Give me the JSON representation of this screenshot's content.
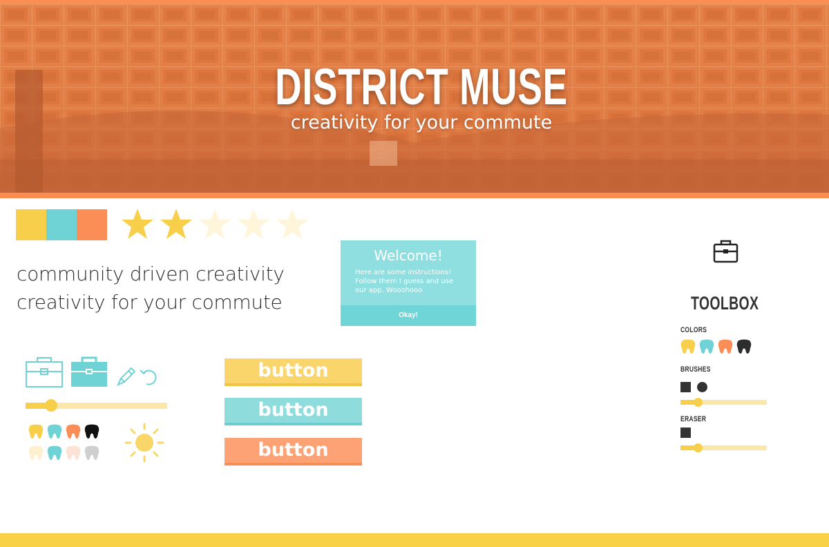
{
  "hero": {
    "title": "DISTRICT MUSE",
    "subtitle": "creativity for your commute"
  },
  "palette": [
    "#f8cf4a",
    "#6fd3d6",
    "#fb8d56"
  ],
  "rating": {
    "value": 2,
    "max": 5,
    "filled_color": "#f8cf4a",
    "empty_color": "#fff5da"
  },
  "taglines": [
    "community driven creativity",
    "creativity for your commute"
  ],
  "dialog": {
    "title": "Welcome!",
    "body": "Here are some instructions! Follow them I guess and use our app. Wooohooo",
    "button": "Okay!"
  },
  "buttons": [
    "button",
    "button",
    "button"
  ],
  "left_slider": {
    "value": 0.18
  },
  "toolbox": {
    "title": "TOOLBOX",
    "colors_label": "COLORS",
    "brushes_label": "BRUSHES",
    "eraser_label": "ERASER",
    "colors": [
      "#f8cf4a",
      "#6fd3d6",
      "#fb8d56",
      "#2d2d2d"
    ],
    "brush_slider": {
      "value": 0.2
    },
    "eraser_slider": {
      "value": 0.2
    }
  },
  "paint_swatches": {
    "row1": [
      "#f8cf4a",
      "#6fd3d6",
      "#fb8d56",
      "#111111"
    ],
    "row2": [
      "#fff1cf",
      "#6fd3d6",
      "#fde2d7",
      "#cfcfcf"
    ]
  },
  "icons": [
    "toolbox-outline-icon",
    "toolbox-filled-icon",
    "brush-icon",
    "undo-icon",
    "sun-icon",
    "briefcase-icon"
  ]
}
